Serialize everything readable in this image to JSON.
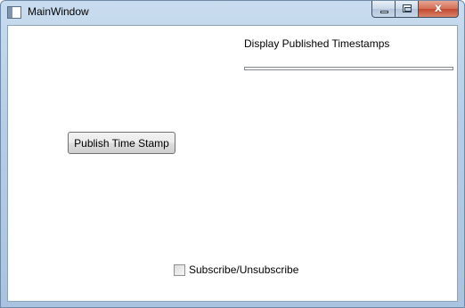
{
  "window": {
    "title": "MainWindow",
    "icon": "app-window-icon",
    "controls": {
      "minimize_icon": "minimize-icon",
      "maximize_icon": "maximize-icon",
      "close_icon": "close-icon",
      "close_glyph": "x"
    }
  },
  "main": {
    "display_label": "Display Published Timestamps",
    "timestamps": [],
    "publish_button_label": "Publish Time Stamp",
    "subscribe_checkbox": {
      "label": "Subscribe/Unsubscribe",
      "checked": false
    }
  },
  "colors": {
    "title_bar": "#b6cde6",
    "close_button": "#c2492d",
    "client_background": "#ffffff"
  }
}
